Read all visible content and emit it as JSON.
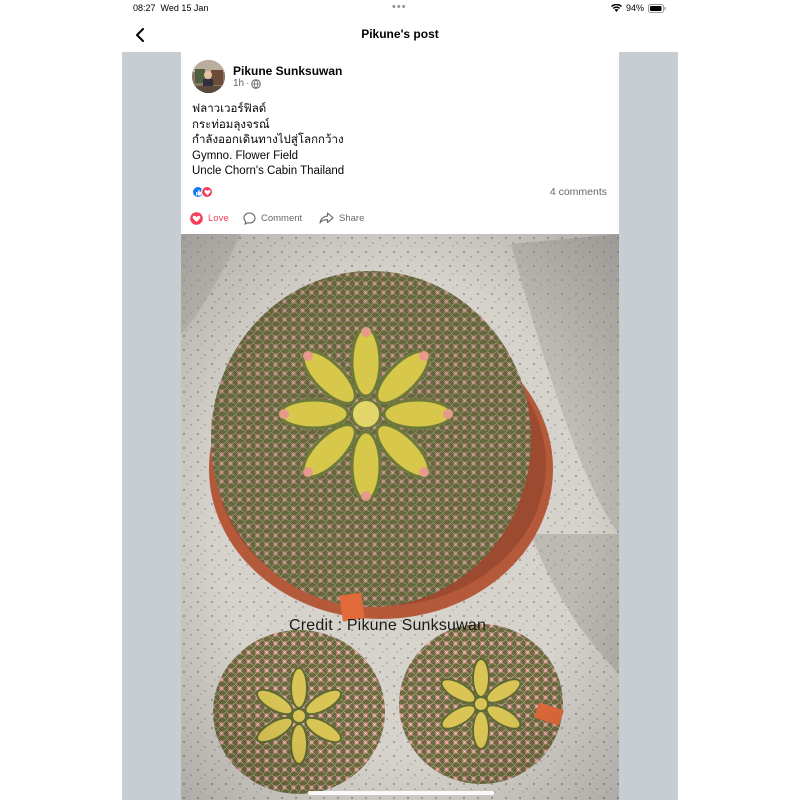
{
  "status_bar": {
    "time": "08:27",
    "date": "Wed 15 Jan",
    "battery": "94%",
    "icons": [
      "wifi-icon",
      "battery-icon"
    ]
  },
  "nav": {
    "title": "Pikune's post",
    "back_icon": "chevron-left-icon"
  },
  "post": {
    "author": "Pikune Sunksuwan",
    "time_ago": "1h",
    "privacy_icon": "globe-icon",
    "text_lines": [
      "ฟลาวเวอร์ฟิลด์",
      "กระท่อมลุงจรณ์",
      "กำลังออกเดินทางไปสู่โลกกว้าง",
      "Gymno. Flower Field",
      "Uncle Chorn's Cabin Thailand"
    ],
    "reaction_icons": [
      "like-icon",
      "heart-icon"
    ],
    "comments_count": "4 comments",
    "actions": {
      "love": "Love",
      "comment": "Comment",
      "share": "Share"
    }
  },
  "photo": {
    "watermark": "Credit : Pikune Sunksuwan"
  },
  "colors": {
    "accent_blue": "#1877f2",
    "love_red": "#f33e58",
    "content_bg": "#c8cdd3"
  }
}
